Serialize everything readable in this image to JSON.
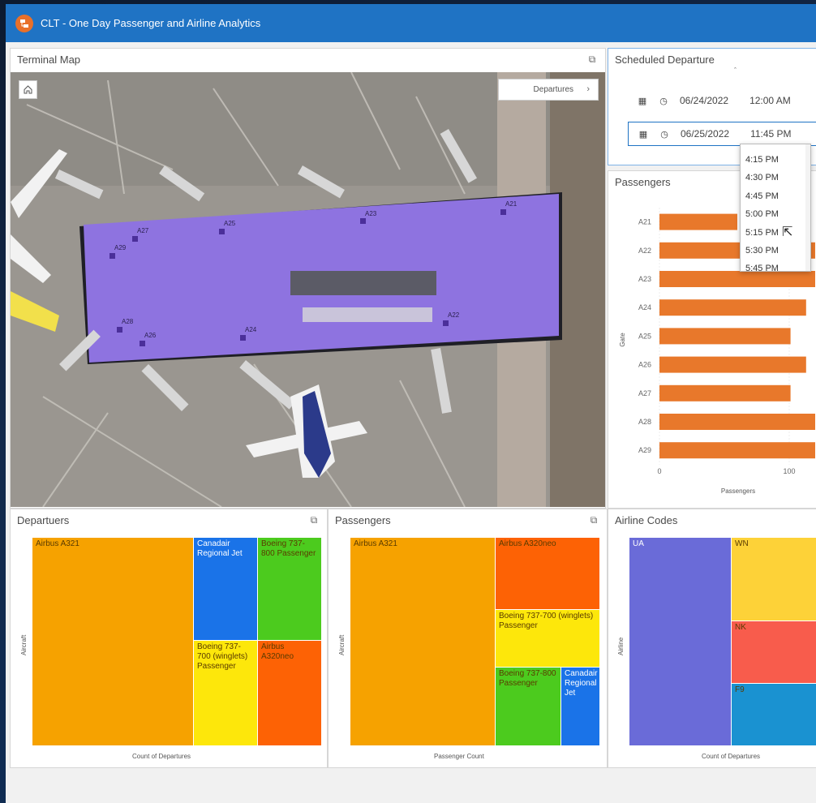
{
  "header": {
    "title": "CLT - One Day Passenger and Airline Analytics",
    "icon": "dashboard-icon"
  },
  "terminal_map": {
    "title": "Terminal Map",
    "departures_button": "Departures",
    "gates": [
      "A21",
      "A22",
      "A23",
      "A24",
      "A25",
      "A26",
      "A27",
      "A28",
      "A29"
    ],
    "concourse_color": "#8e73e0"
  },
  "scheduled_departure": {
    "title": "Scheduled Departure",
    "start": {
      "date": "06/24/2022",
      "time": "12:00 AM"
    },
    "end": {
      "date": "06/25/2022",
      "time": "11:45 PM"
    },
    "time_options": [
      "4:15 PM",
      "4:30 PM",
      "4:45 PM",
      "5:00 PM",
      "5:15 PM",
      "5:30 PM",
      "5:45 PM"
    ]
  },
  "passengers_panel": {
    "title": "Passengers"
  },
  "departures_panel": {
    "title": "Departuers"
  },
  "passengers_treemap_panel": {
    "title": "Passengers"
  },
  "airline_panel": {
    "title": "Airline Codes"
  },
  "colors": {
    "orange": "#f6a200",
    "bar": "#e8782b",
    "blue": "#1a73e8",
    "green": "#4ccb1e",
    "yellow": "#fde70b",
    "red_orange": "#fd6205",
    "purple": "#6a6bd8",
    "gold": "#fdd238",
    "coral": "#f85c4c",
    "teal": "#1a92d1"
  },
  "chart_data": [
    {
      "type": "bar",
      "orientation": "horizontal",
      "categories": [
        "A21",
        "A22",
        "A23",
        "A24",
        "A25",
        "A26",
        "A27",
        "A28",
        "A29"
      ],
      "values": [
        60,
        120,
        120,
        113,
        101,
        113,
        101,
        120,
        120
      ],
      "xlabel": "Passengers",
      "ylabel": "Gate",
      "xticks": [
        "0",
        "100"
      ],
      "xlim": [
        0,
        120
      ]
    },
    {
      "type": "treemap",
      "xlabel": "Count of Departures",
      "ylabel": "Aircraft",
      "labels": [
        "Airbus A321",
        "Canadair Regional Jet",
        "Boeing 737-800 Passenger",
        "Boeing 737-700 (winglets) Passenger",
        "Airbus A320neo"
      ]
    },
    {
      "type": "treemap",
      "xlabel": "Passenger Count",
      "ylabel": "Aircraft",
      "labels": [
        "Airbus A321",
        "Airbus A320neo",
        "Boeing 737-700 (winglets) Passenger",
        "Boeing 737-800 Passenger",
        "Canadair Regional Jet"
      ]
    },
    {
      "type": "treemap",
      "xlabel": "Count of Departures",
      "ylabel": "Airline",
      "labels": [
        "UA",
        "WN",
        "NK",
        "F9"
      ]
    }
  ]
}
